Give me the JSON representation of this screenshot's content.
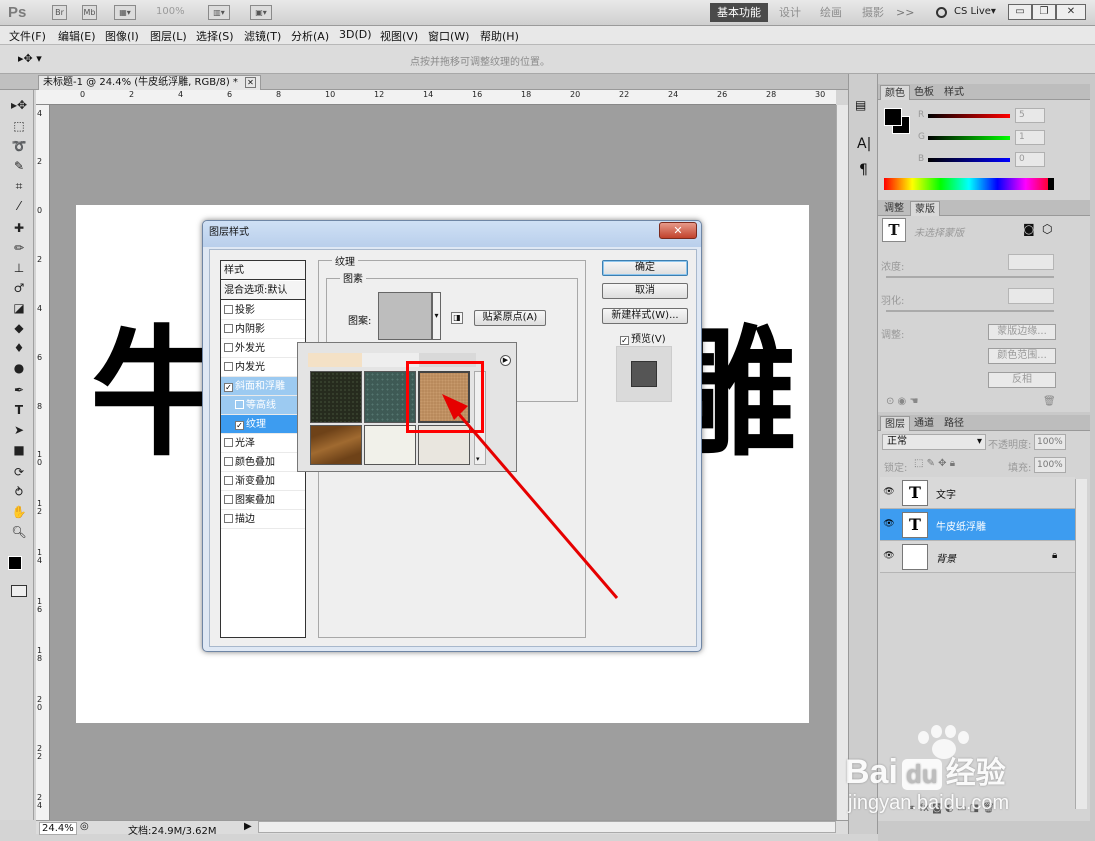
{
  "app": {
    "logo": "Ps",
    "workspace_active": "基本功能",
    "workspaces": [
      "设计",
      "绘画",
      "摄影"
    ],
    "more": ">>",
    "cslive": "CS Live▾",
    "zoom_combo": "100%"
  },
  "menu": [
    "文件(F)",
    "编辑(E)",
    "图像(I)",
    "图层(L)",
    "选择(S)",
    "滤镜(T)",
    "分析(A)",
    "3D(D)",
    "视图(V)",
    "窗口(W)",
    "帮助(H)"
  ],
  "options_hint": "点按并拖移可调整纹理的位置。",
  "document": {
    "tab_title": "未标题-1 @ 24.4% (牛皮纸浮雕, RGB/8) *",
    "char_left": "牛",
    "char_right": "雕",
    "zoom": "24.4%",
    "doc_info": "文档:24.9M/3.62M"
  },
  "ruler_top": [
    "0",
    "2",
    "4",
    "6",
    "8",
    "10",
    "12",
    "14",
    "16",
    "18",
    "20",
    "22",
    "24",
    "26",
    "28",
    "30"
  ],
  "ruler_left": [
    "4",
    "2",
    "0",
    "2",
    "4",
    "6",
    "8",
    "1 0",
    "1 2",
    "1 4",
    "1 6",
    "1 8",
    "2 0",
    "2 2",
    "2 4"
  ],
  "dialog": {
    "title": "图层样式",
    "close": "✕",
    "styles": [
      {
        "label": "样式",
        "type": "hdr"
      },
      {
        "label": "混合选项:默认",
        "type": "hdr"
      },
      {
        "label": "投影",
        "checked": false
      },
      {
        "label": "内阴影",
        "checked": false
      },
      {
        "label": "外发光",
        "checked": false
      },
      {
        "label": "内发光",
        "checked": false
      },
      {
        "label": "斜面和浮雕",
        "checked": true
      },
      {
        "label": "等高线",
        "checked": false,
        "sub": true
      },
      {
        "label": "纹理",
        "checked": true,
        "sub": true
      },
      {
        "label": "光泽",
        "checked": false
      },
      {
        "label": "颜色叠加",
        "checked": false
      },
      {
        "label": "渐变叠加",
        "checked": false
      },
      {
        "label": "图案叠加",
        "checked": false
      },
      {
        "label": "描边",
        "checked": false
      }
    ],
    "section_title": "纹理",
    "group_title": "图素",
    "pattern_label": "图案:",
    "snap_button": "贴紧原点(A)",
    "ok": "确定",
    "cancel": "取消",
    "new_style": "新建样式(W)...",
    "preview_label": "预览(V)",
    "preview_checked": true
  },
  "colors": {
    "accent": "#3d9cf0",
    "highlight": "#ff0000",
    "swatches": [
      "#262b1e",
      "#3e5a55",
      "#b98a5c",
      "#8a5a2a",
      "#f1f1ea",
      "#e9e6df"
    ]
  },
  "color_panel": {
    "tabs": [
      "颜色",
      "色板",
      "样式"
    ],
    "channels": [
      {
        "label": "R",
        "value": "5"
      },
      {
        "label": "G",
        "value": "1"
      },
      {
        "label": "B",
        "value": "0"
      }
    ]
  },
  "adjust_panel": {
    "tabs": [
      "调整",
      "蒙版"
    ],
    "title": "未选择蒙版",
    "density": "浓度:",
    "feather": "羽化:",
    "adjust": "调整:",
    "btn_edge": "蒙版边缘...",
    "btn_range": "颜色范围...",
    "btn_invert": "反相"
  },
  "layers_panel": {
    "tabs": [
      "图层",
      "通道",
      "路径"
    ],
    "blend_mode": "正常",
    "opacity_label": "不透明度:",
    "opacity": "100%",
    "lock_label": "锁定:",
    "fill_label": "填充:",
    "fill": "100%",
    "layers": [
      {
        "name": "文字",
        "type": "T",
        "selected": false
      },
      {
        "name": "牛皮纸浮雕",
        "type": "T",
        "selected": true
      },
      {
        "name": "背景",
        "type": "bg",
        "selected": false
      }
    ]
  },
  "watermark": {
    "line1": "Bai",
    "line1b": "du",
    "line1c": "经验",
    "line2": "jingyan.baidu.com"
  }
}
